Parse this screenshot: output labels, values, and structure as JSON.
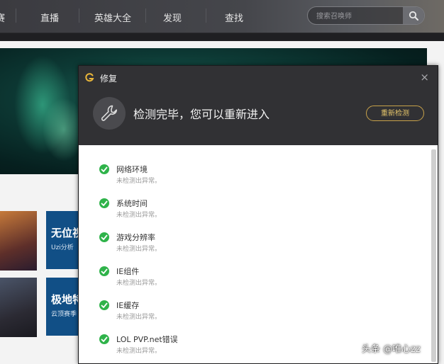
{
  "nav": {
    "items": [
      {
        "label": "赛"
      },
      {
        "label": "直播"
      },
      {
        "label": "英雄大全"
      },
      {
        "label": "发现"
      },
      {
        "label": "查找"
      }
    ],
    "search_placeholder": "搜索召唤师"
  },
  "background": {
    "promos": [
      {
        "title": "无位视",
        "subtitle": "Uzi分析"
      },
      {
        "title": "极地特",
        "subtitle": "云顶赛季"
      }
    ]
  },
  "dialog": {
    "title": "修复",
    "close_label": "×",
    "status_message": "检测完毕，您可以重新进入",
    "recheck_label": "重新检测",
    "items": [
      {
        "title": "网络环境",
        "status": "未检测出异常。"
      },
      {
        "title": "系统时间",
        "status": "未检测出异常。"
      },
      {
        "title": "游戏分辨率",
        "status": "未检测出异常。"
      },
      {
        "title": "IE组件",
        "status": "未检测出异常。"
      },
      {
        "title": "IE缓存",
        "status": "未检测出异常。"
      },
      {
        "title": "LOL PVP.net错误",
        "status": "未检测出异常。"
      }
    ]
  },
  "watermark": "头条 @唯心zz",
  "colors": {
    "accent_gold": "#c8a24a",
    "check_green": "#2fb34a",
    "dialog_header": "#313134",
    "promo_blue": "#114f86"
  }
}
